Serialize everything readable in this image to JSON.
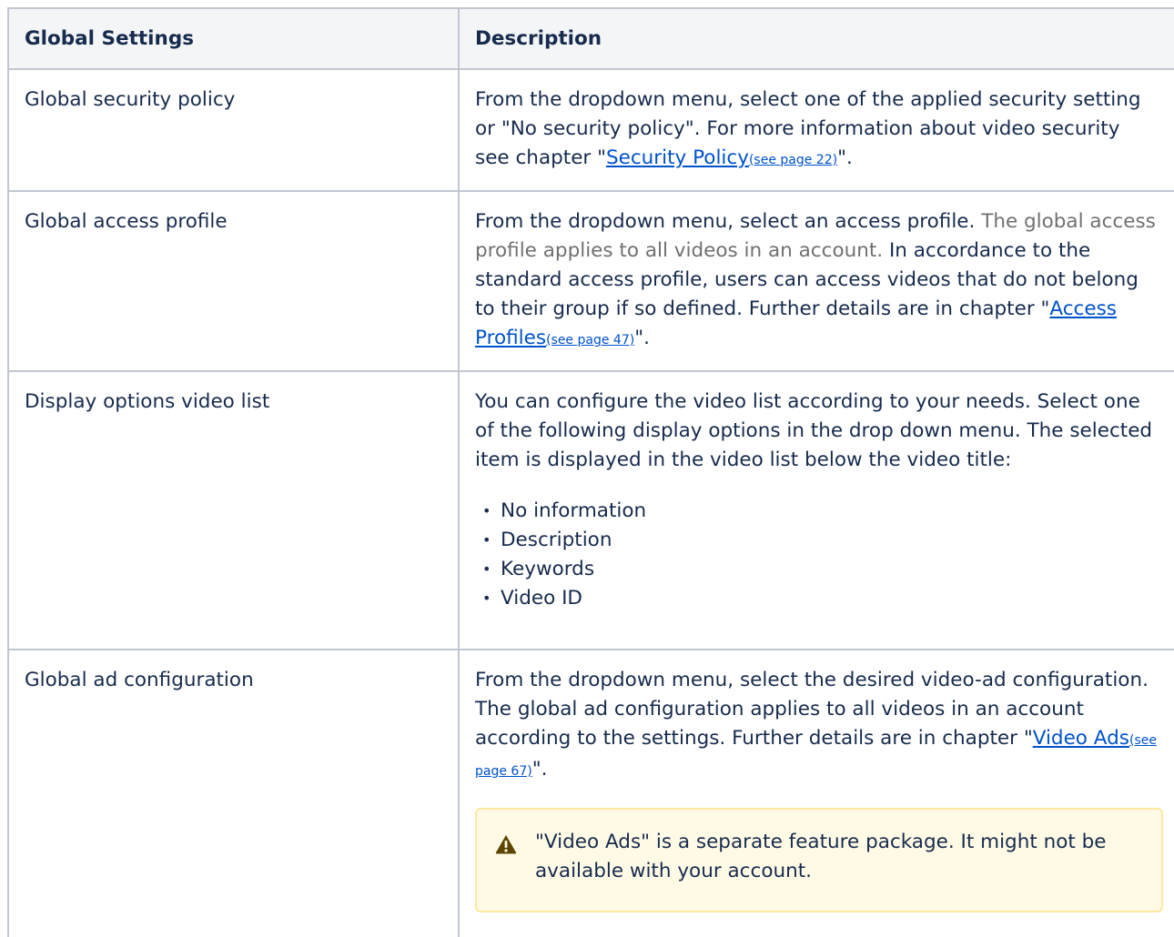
{
  "table": {
    "headers": [
      "Global Settings",
      "Description"
    ],
    "rows": [
      {
        "setting": "Global security policy",
        "desc_text": "From the dropdown menu, select one of the applied security setting or \"No security policy\". For more information about video security see chapter \"",
        "link": "Security Policy",
        "pageref": "(see page 22)",
        "tail": "\"."
      },
      {
        "setting": "Global access profile",
        "desc_text": "From the dropdown menu, select an access profile. ",
        "desc_muted": "The global access profile applies to all videos in an account.",
        "desc_text2": " In accordance to the standard access profile, users can access videos that do not belong to their group if so defined. Further details are in chapter \"",
        "link": "Access Profiles",
        "pageref": "(see page 47)",
        "tail": "\"."
      },
      {
        "setting": "Display options video list",
        "desc_text": "You can configure the video list according to your needs. Select one of the following display options in the drop down menu. The selected item is displayed in the video list below the video title:",
        "options": [
          "No information",
          "Description",
          "Keywords",
          "Video ID"
        ]
      },
      {
        "setting": "Global ad configuration",
        "desc_text": "From the dropdown menu, select the desired video-ad configuration. The global ad configuration applies to all videos in an account according to the settings. Further details are in chapter \"",
        "link": "Video Ads",
        "pageref": "(see page 67)",
        "tail": "\".",
        "warning": "\"Video Ads\" is a separate feature package. It might not be available with your account."
      }
    ]
  },
  "colors": {
    "border": "#c1c7d0",
    "header_bg": "#f4f5f7",
    "link": "#0052cc",
    "warning_bg": "#fffae6",
    "warning_border": "#ffe7a1",
    "warning_icon": "#5c4600"
  },
  "icons": {
    "warning": "warning-triangle-icon"
  }
}
